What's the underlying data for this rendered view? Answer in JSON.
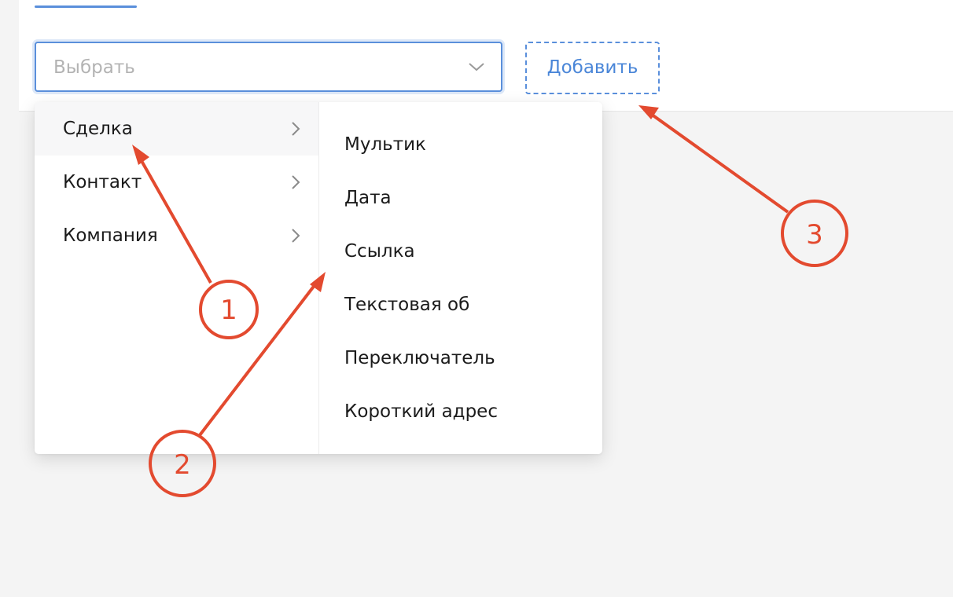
{
  "select": {
    "placeholder": "Выбрать",
    "arrow_icon": "chevron-down-icon"
  },
  "add_button": {
    "label": "Добавить"
  },
  "menu": {
    "categories": [
      {
        "label": "Сделка",
        "icon": "chevron-right-icon",
        "active": true
      },
      {
        "label": "Контакт",
        "icon": "chevron-right-icon",
        "active": false
      },
      {
        "label": "Компания",
        "icon": "chevron-right-icon",
        "active": false
      }
    ],
    "fields": [
      {
        "label": "Мультик"
      },
      {
        "label": "Дата"
      },
      {
        "label": "Ссылка"
      },
      {
        "label": "Текстовая об"
      },
      {
        "label": "Переключатель"
      },
      {
        "label": "Короткий адрес"
      }
    ]
  },
  "annotations": [
    {
      "number": "1"
    },
    {
      "number": "2"
    },
    {
      "number": "3"
    }
  ],
  "colors": {
    "accent": "#5a8fdb",
    "annotation": "#e34a2f",
    "background": "#f4f4f4"
  }
}
